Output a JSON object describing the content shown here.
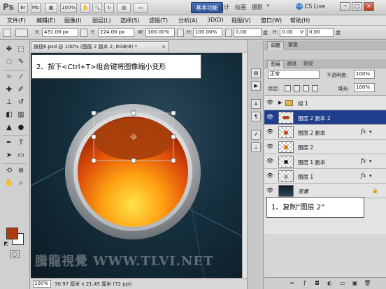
{
  "titlebar": {
    "app_logo": "Ps",
    "zoom": "100%",
    "workspaces": [
      "基本功能",
      "设计",
      "绘画",
      "摄影"
    ],
    "workspace_more": "»",
    "cs_live": "CS Live",
    "window_buttons": [
      "─",
      "□",
      "×"
    ]
  },
  "menubar": {
    "items": [
      "文件(F)",
      "编辑(E)",
      "图像(I)",
      "图层(L)",
      "选择(S)",
      "滤镜(T)",
      "分析(A)",
      "3D(D)",
      "视图(V)",
      "窗口(W)",
      "帮助(H)"
    ]
  },
  "options": {
    "x_label": "X:",
    "x_value": "431.00 px",
    "y_label": "Y:",
    "y_value": "224.00 px",
    "w_label": "W:",
    "w_value": "100.00%",
    "h_label": "H:",
    "h_value": "100.00%",
    "angle_value": "0.00",
    "angle_unit": "度",
    "h_skew_label": "H:",
    "h_skew_value": "0.00",
    "v_skew_label": "V:",
    "v_skew_value": "0.00",
    "skew_unit": "度"
  },
  "tools": {
    "foreground_color": "#b33a0c",
    "background_color": "#ffffff"
  },
  "document": {
    "tab_title": "按钮6.psd @ 100% (图层 2 副本 2, RGB/8) *",
    "tab_close": "×",
    "zoom_value": "100%",
    "status_info": "30.97 厘米 x 21.45 厘米 (72 ppi)",
    "watermark": "騰龍視覺 WWW.TLVI.NET"
  },
  "callouts": {
    "step2": "2、按下<Ctrl+T>组合键将图像缩小变形",
    "step1": "1、复制“图层 2”"
  },
  "panels": {
    "top_tabs": [
      "调整",
      "蒙版"
    ],
    "tabs": [
      "图层",
      "通道",
      "路径"
    ],
    "blend_mode": "正常",
    "opacity_label": "不透明度:",
    "opacity_value": "100%",
    "lock_label": "锁定:",
    "fill_label": "填充:",
    "fill_value": "100%",
    "layers": [
      {
        "name": "组 1",
        "type": "group"
      },
      {
        "name": "图层 2 副本 2",
        "selected": true
      },
      {
        "name": "图层 2 副本",
        "fx": "fx"
      },
      {
        "name": "图层 2"
      },
      {
        "name": "图层 1 副本",
        "fx": "fx"
      },
      {
        "name": "图层 1",
        "fx": "fx"
      },
      {
        "name": "背景",
        "lock": "🔒"
      }
    ]
  }
}
